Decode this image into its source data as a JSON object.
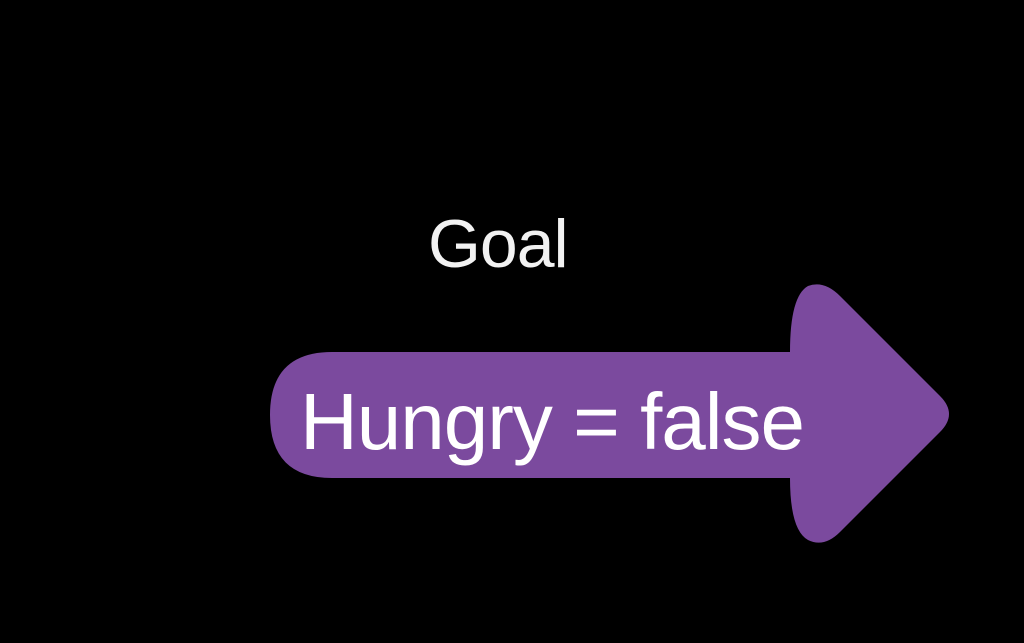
{
  "diagram": {
    "goal_label": "Goal",
    "state_text": "Hungry = false"
  },
  "colors": {
    "background": "#000000",
    "arrow_fill": "#7b4a9e",
    "text": "#ffffff"
  }
}
